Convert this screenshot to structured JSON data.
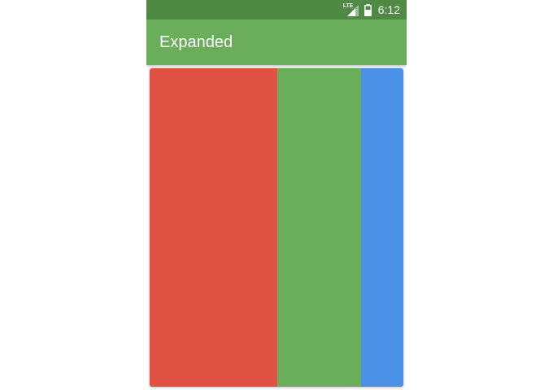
{
  "status_bar": {
    "network_label": "LTE",
    "signal_icon": "cell-signal-icon",
    "battery_icon": "battery-icon",
    "time": "6:12"
  },
  "app_bar": {
    "title": "Expanded"
  },
  "panels": [
    {
      "name": "red",
      "color": "#df5242"
    },
    {
      "name": "green",
      "color": "#6aae5c"
    },
    {
      "name": "blue",
      "color": "#4c91e8"
    }
  ],
  "colors": {
    "status_bar": "#4f8a45",
    "app_bar": "#6aae5c"
  }
}
